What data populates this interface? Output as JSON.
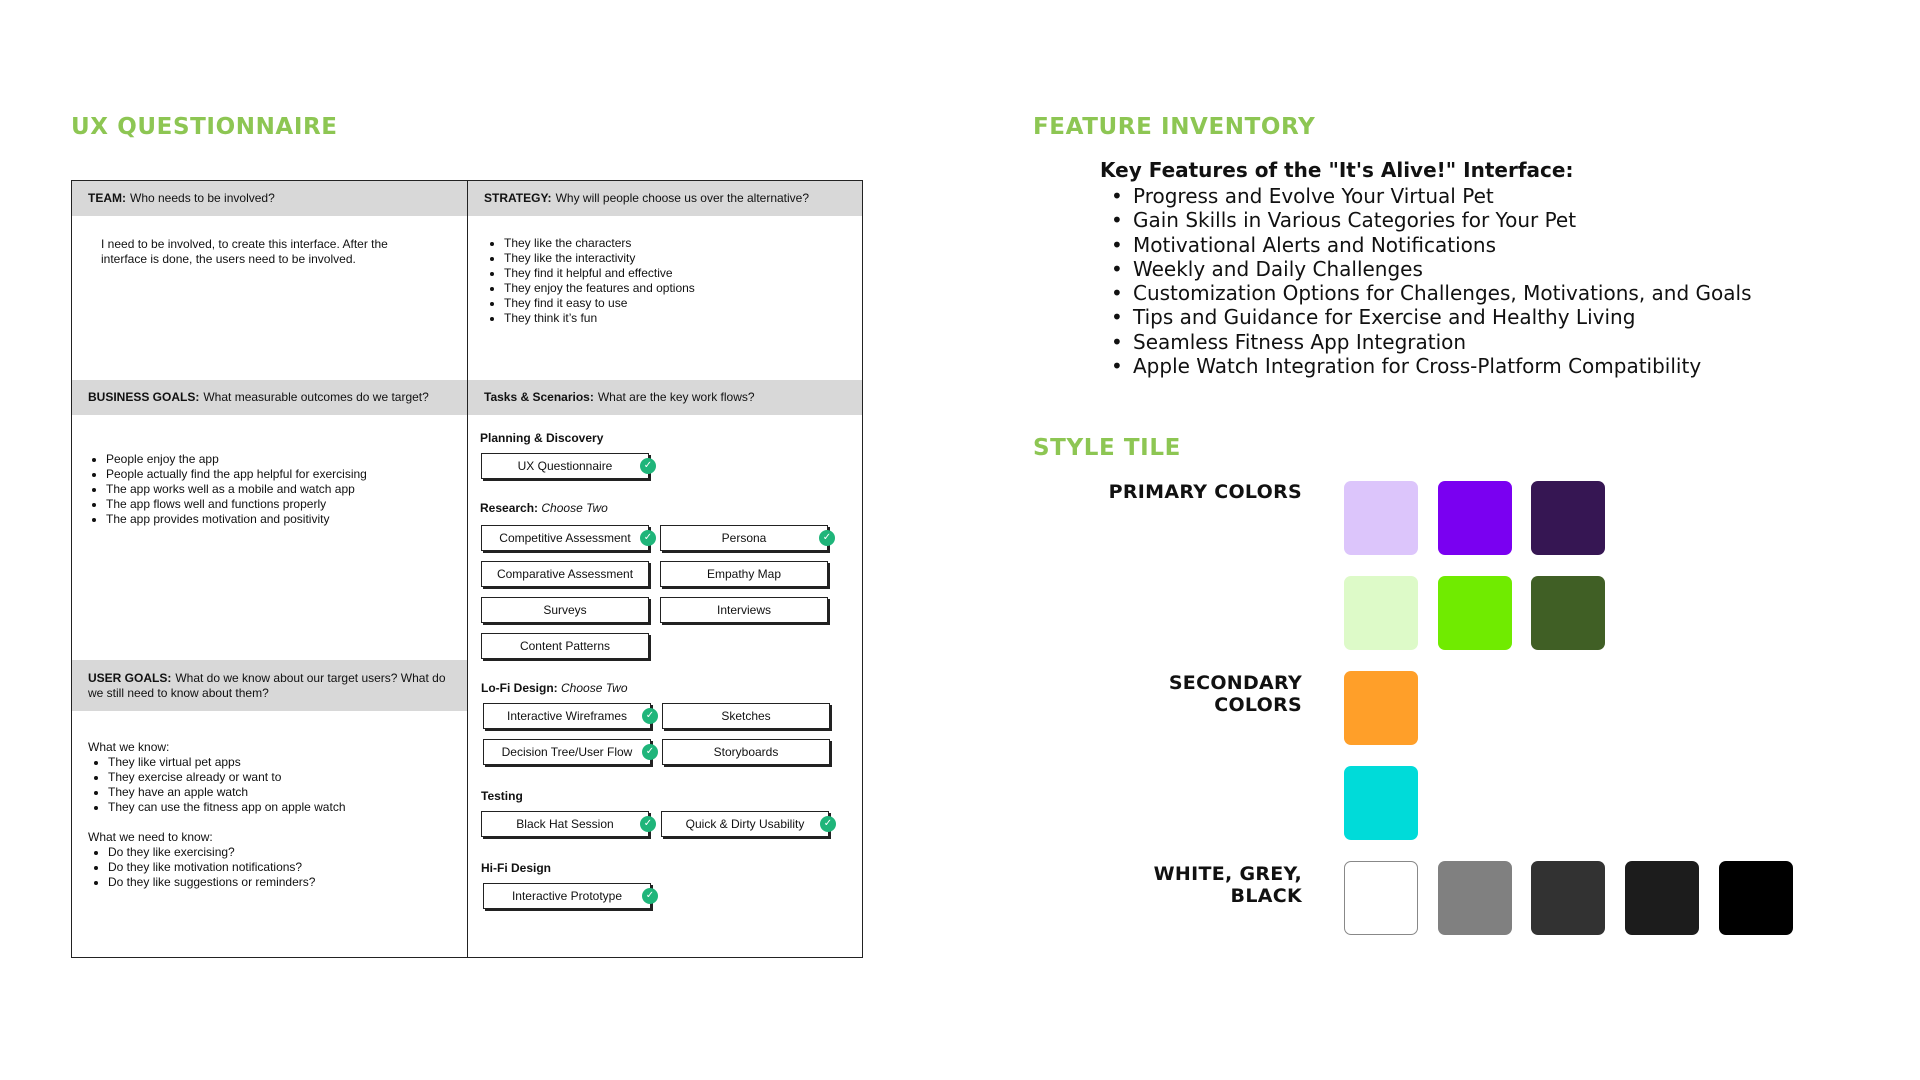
{
  "ux_questionnaire": {
    "title": "UX QUESTIONNAIRE",
    "team": {
      "label": "TEAM:",
      "question": "Who needs to be involved?",
      "answer": "I need to be involved, to create this interface. After the interface is done, the users need to be involved."
    },
    "strategy": {
      "label": "STRATEGY:",
      "question": "Why will people choose us over the alternative?",
      "items": [
        "They like the characters",
        "They like the interactivity",
        "They find it helpful and effective",
        "They enjoy the features and options",
        "They find it easy to use",
        "They think it’s fun"
      ]
    },
    "business_goals": {
      "label": "BUSINESS GOALS:",
      "question": "What measurable outcomes do we target?",
      "items": [
        "People enjoy the app",
        "People actually find the app helpful for exercising",
        "The app works well as a mobile and watch app",
        "The app flows well and functions properly",
        "The app provides motivation and positivity"
      ]
    },
    "tasks": {
      "label": "Tasks & Scenarios:",
      "question": "What are the key work flows?",
      "planning_label": "Planning & Discovery",
      "research_label": "Research:",
      "research_note": "Choose Two",
      "lofi_label": "Lo-Fi Design:",
      "lofi_note": "Choose Two",
      "testing_label": "Testing",
      "hifi_label": "Hi-Fi Design",
      "ux_questionnaire": "UX Questionnaire",
      "competitive_assessment": "Competitive Assessment",
      "persona": "Persona",
      "comparative_assessment": "Comparative Assessment",
      "empathy_map": "Empathy Map",
      "surveys": "Surveys",
      "interviews": "Interviews",
      "content_patterns": "Content Patterns",
      "interactive_wireframes": "Interactive Wireframes",
      "sketches": "Sketches",
      "decision_tree": "Decision Tree/User Flow",
      "storyboards": "Storyboards",
      "black_hat": "Black Hat Session",
      "quick_dirty": "Quick & Dirty Usability",
      "interactive_prototype": "Interactive Prototype"
    },
    "user_goals": {
      "label": "USER GOALS:",
      "question": "What do we know about our target users? What do we still need to know about them?",
      "know_label": "What we know:",
      "know_items": [
        "They like virtual pet apps",
        "They exercise already or want to",
        "They have an apple watch",
        "They can use the fitness app on apple watch"
      ],
      "need_label": "What we need to know:",
      "need_items": [
        "Do they like exercising?",
        "Do they like motivation notifications?",
        "Do they like suggestions or reminders?"
      ]
    }
  },
  "feature_inventory": {
    "title": "FEATURE INVENTORY",
    "heading": "Key Features of the \"It's Alive!\" Interface:",
    "items": [
      "Progress and Evolve Your Virtual Pet",
      "Gain Skills in Various Categories for Your Pet",
      "Motivational Alerts and Notifications",
      "Weekly and Daily Challenges",
      "Customization Options for Challenges, Motivations, and Goals",
      "Tips and Guidance for Exercise and Healthy Living",
      "Seamless Fitness App Integration",
      "Apple Watch Integration for Cross-Platform Compatibility"
    ]
  },
  "style_tile": {
    "title": "STYLE TILE",
    "primary_label": "PRIMARY COLORS",
    "secondary_label": "SECONDARY COLORS",
    "neutral_label": "WHITE, GREY, BLACK",
    "colors": {
      "primary_light_purple": "#dcc5fb",
      "primary_purple": "#7a00f1",
      "primary_dark_purple": "#361653",
      "primary_light_green": "#ddfac8",
      "primary_green": "#70eb00",
      "primary_dark_green": "#405f25",
      "secondary_orange": "#ff9f29",
      "secondary_cyan": "#00dbd9",
      "white": "#ffffff",
      "grey": "#808080",
      "dark_grey": "#323232",
      "near_black": "#1c1c1c",
      "black": "#000000"
    }
  }
}
